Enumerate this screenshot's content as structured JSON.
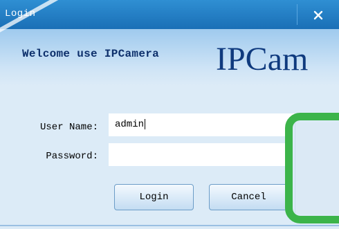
{
  "window": {
    "title": "Login",
    "close_icon": "close-icon"
  },
  "banner": {
    "welcome": "Welcome use IPCamera",
    "logo": "IPCam"
  },
  "form": {
    "username_label": "User Name:",
    "username_value": "admin",
    "password_label": "Password:",
    "password_value": ""
  },
  "buttons": {
    "login": "Login",
    "cancel": "Cancel"
  },
  "colors": {
    "titlebar": "#1a6fb6",
    "background": "#dcebf7",
    "logo": "#0f3a7e",
    "overlay_border": "#3cb44a"
  }
}
